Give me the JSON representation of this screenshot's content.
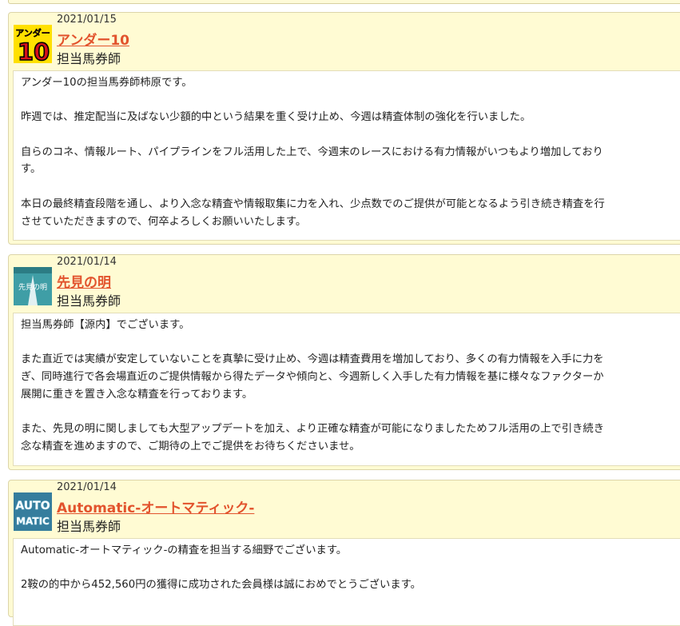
{
  "posts": [
    {
      "date": "2021/01/15",
      "name": "アンダー10",
      "role": "担当馬券師",
      "logo_text": [
        "アンダー",
        "10"
      ],
      "lines": [
        "アンダー10の担当馬券師柿原です。",
        "",
        "昨週では、推定配当に及ばない少額的中という結果を重く受け止め、今週は精査体制の強化を行いました。",
        "",
        "自らのコネ、情報ルート、パイプラインをフル活用した上で、今週末のレースにおける有力情報がいつもより増加しており",
        "す。",
        "",
        "本日の最終精査段階を通し、より入念な精査や情報取集に力を入れ、少点数でのご提供が可能となるよう引き続き精査を行",
        "させていただきますので、何卒よろしくお願いいたします。"
      ]
    },
    {
      "date": "2021/01/14",
      "name": "先見の明",
      "role": "担当馬券師",
      "logo_text": [
        "先見の明"
      ],
      "lines": [
        "担当馬券師【源内】でございます。",
        "",
        "また直近では実績が安定していないことを真摯に受け止め、今週は精査費用を増加しており、多くの有力情報を入手に力を",
        "ぎ、同時進行で各会場直近のご提供情報から得たデータや傾向と、今週新しく入手した有力情報を基に様々なファクターか",
        "展開に重きを置き入念な精査を行っております。",
        "",
        "また、先見の明に関しましても大型アップデートを加え、より正確な精査が可能になりましたためフル活用の上で引き続き",
        "念な精査を進めますので、ご期待の上でご提供をお待ちくださいませ。"
      ]
    },
    {
      "date": "2021/01/14",
      "name": "Automatic-オートマティック-",
      "role": "担当馬券師",
      "logo_text": [
        "AUTO",
        "MATIC"
      ],
      "lines": [
        "Automatic-オートマティック-の精査を担当する細野でございます。",
        "",
        "2鞍の的中から452,560円の獲得に成功された会員様は誠におめでとうございます。"
      ]
    }
  ]
}
